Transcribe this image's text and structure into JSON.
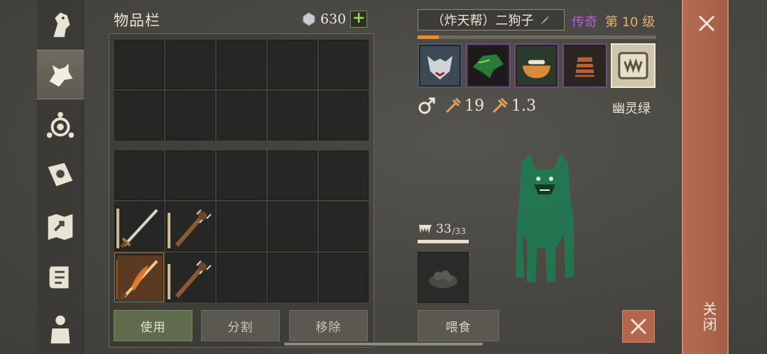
{
  "inventory": {
    "title": "物品栏",
    "currency_value": "630",
    "add_button": "+",
    "grid_top_slots": 10,
    "grid_bottom": [
      {
        "item": null
      },
      {
        "item": null
      },
      {
        "item": null
      },
      {
        "item": null
      },
      {
        "item": null
      },
      {
        "item": "sword",
        "icon": "sword-icon",
        "level": 0.9
      },
      {
        "item": "spiked-club",
        "icon": "club-icon",
        "level": 0.8
      },
      {
        "item": null
      },
      {
        "item": null
      },
      {
        "item": null
      },
      {
        "item": "flame-sword",
        "icon": "flame-sword-icon",
        "level": 0.9
      },
      {
        "item": "spiked-club",
        "icon": "club-icon",
        "level": 0.8
      },
      {
        "item": null
      },
      {
        "item": null
      },
      {
        "item": null
      }
    ],
    "buttons": {
      "use": "使用",
      "split": "分割",
      "remove": "移除"
    }
  },
  "pet": {
    "name": "（炸天帮）二狗子",
    "rarity": "传奇",
    "level": "第 10 级",
    "xp_fraction": 0.09,
    "skills": [
      "wolf-head-icon",
      "green-dragon-icon",
      "bowl-bone-icon",
      "striped-bell-icon",
      "fang-card-icon"
    ],
    "attack": "19",
    "speed": "1.3",
    "color_name": "幽灵绿",
    "hunger": "33",
    "hunger_max": "/33",
    "hunger_fraction": 1.0,
    "feed_button": "喂食"
  },
  "close": {
    "label": "关闭"
  },
  "colors": {
    "rarity": "#b25ee0",
    "level": "#e0b272",
    "accent_close": "#b46d51",
    "wolf": "#1f7a52"
  }
}
